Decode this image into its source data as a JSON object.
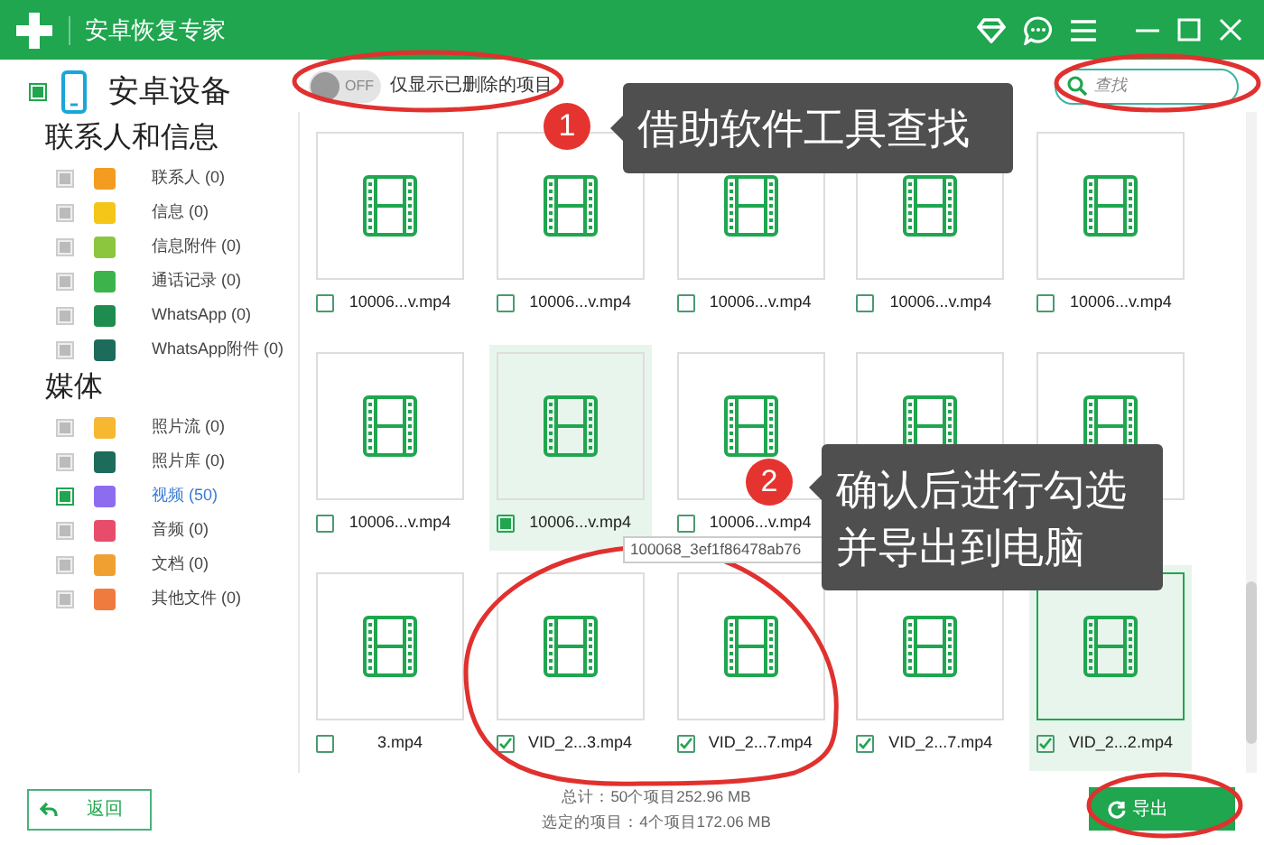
{
  "window": {
    "title": "安卓恢复专家"
  },
  "sidebar": {
    "device": "安卓设备",
    "device_checked": true,
    "groups": [
      {
        "title": "联系人和信息",
        "items": [
          {
            "label": "联系人 (0)",
            "selected": false,
            "color": "#f39c1f"
          },
          {
            "label": "信息 (0)",
            "selected": false,
            "color": "#f5c518"
          },
          {
            "label": "信息附件 (0)",
            "selected": false,
            "color": "#8cc63f"
          },
          {
            "label": "通话记录 (0)",
            "selected": false,
            "color": "#3cb44b"
          },
          {
            "label": "WhatsApp (0)",
            "selected": false,
            "color": "#1e8c4e"
          },
          {
            "label": "WhatsApp附件 (0)",
            "selected": false,
            "color": "#1d6b5a"
          }
        ]
      },
      {
        "title": "媒体",
        "items": [
          {
            "label": "照片流 (0)",
            "selected": false,
            "color": "#f7b731"
          },
          {
            "label": "照片库 (0)",
            "selected": false,
            "color": "#1d6b5a"
          },
          {
            "label": "视频 (50)",
            "selected": true,
            "color": "#8e6cf0"
          },
          {
            "label": "音频 (0)",
            "selected": false,
            "color": "#e84c6b"
          },
          {
            "label": "文档 (0)",
            "selected": false,
            "color": "#f0a030"
          },
          {
            "label": "其他文件 (0)",
            "selected": false,
            "color": "#f07b3f"
          }
        ]
      }
    ]
  },
  "toggle": {
    "label": "OFF",
    "on": false,
    "caption": "仅显示已删除的项目"
  },
  "search": {
    "placeholder": "查找"
  },
  "files": [
    {
      "name": "10006...v.mp4",
      "checked": false,
      "highlighted": false,
      "framed": false
    },
    {
      "name": "10006...v.mp4",
      "checked": false,
      "highlighted": false,
      "framed": false
    },
    {
      "name": "10006...v.mp4",
      "checked": false,
      "highlighted": false,
      "framed": false
    },
    {
      "name": "10006...v.mp4",
      "checked": false,
      "highlighted": false,
      "framed": false
    },
    {
      "name": "10006...v.mp4",
      "checked": false,
      "highlighted": false,
      "framed": false
    },
    {
      "name": "10006...v.mp4",
      "checked": false,
      "highlighted": false,
      "framed": false
    },
    {
      "name": "10006...v.mp4",
      "checked": false,
      "highlighted": true,
      "framed": false
    },
    {
      "name": "10006...v.mp4",
      "checked": false,
      "highlighted": false,
      "framed": false
    },
    {
      "highlighted": false,
      "framed": false
    },
    {
      "highlighted": false,
      "framed": false
    },
    {
      "name": "3.mp4",
      "checked": false,
      "highlighted": false,
      "framed": false
    },
    {
      "name": "VID_2...3.mp4",
      "checked": true,
      "highlighted": false,
      "framed": false
    },
    {
      "name": "VID_2...7.mp4",
      "checked": true,
      "highlighted": false,
      "framed": false
    },
    {
      "name": "VID_2...7.mp4",
      "checked": true,
      "highlighted": false,
      "framed": false
    },
    {
      "name": "VID_2...2.mp4",
      "checked": true,
      "highlighted": true,
      "framed": true
    }
  ],
  "tooltip": {
    "text": "100068_3ef1f86478ab76"
  },
  "callouts": [
    {
      "number": "1",
      "text": "借助软件工具查找"
    },
    {
      "number": "2",
      "text": "确认后进行勾选并导出到电脑"
    }
  ],
  "status": {
    "total": "总计：50个项目252.96 MB",
    "selected": "选定的项目：4个项目172.06 MB"
  },
  "buttons": {
    "back": "返回",
    "export": "导出"
  }
}
